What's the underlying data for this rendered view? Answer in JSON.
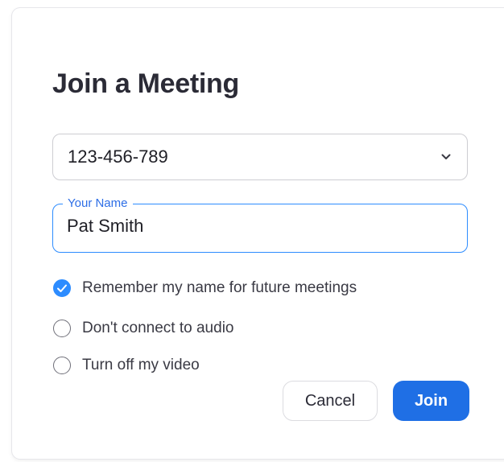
{
  "dialog": {
    "title": "Join a Meeting",
    "meeting_id": {
      "value": "123-456-789",
      "icon": "chevron-down-icon"
    },
    "name_field": {
      "label": "Your Name",
      "value": "Pat Smith"
    },
    "options": [
      {
        "label": "Remember my name for future meetings",
        "checked": true
      },
      {
        "label": "Don't connect to audio",
        "checked": false
      },
      {
        "label": "Turn off my video",
        "checked": false
      }
    ],
    "buttons": {
      "cancel": "Cancel",
      "join": "Join"
    }
  },
  "colors": {
    "accent": "#2d8cff",
    "join_button": "#1f6fe5",
    "title_text": "#2b2b36"
  }
}
